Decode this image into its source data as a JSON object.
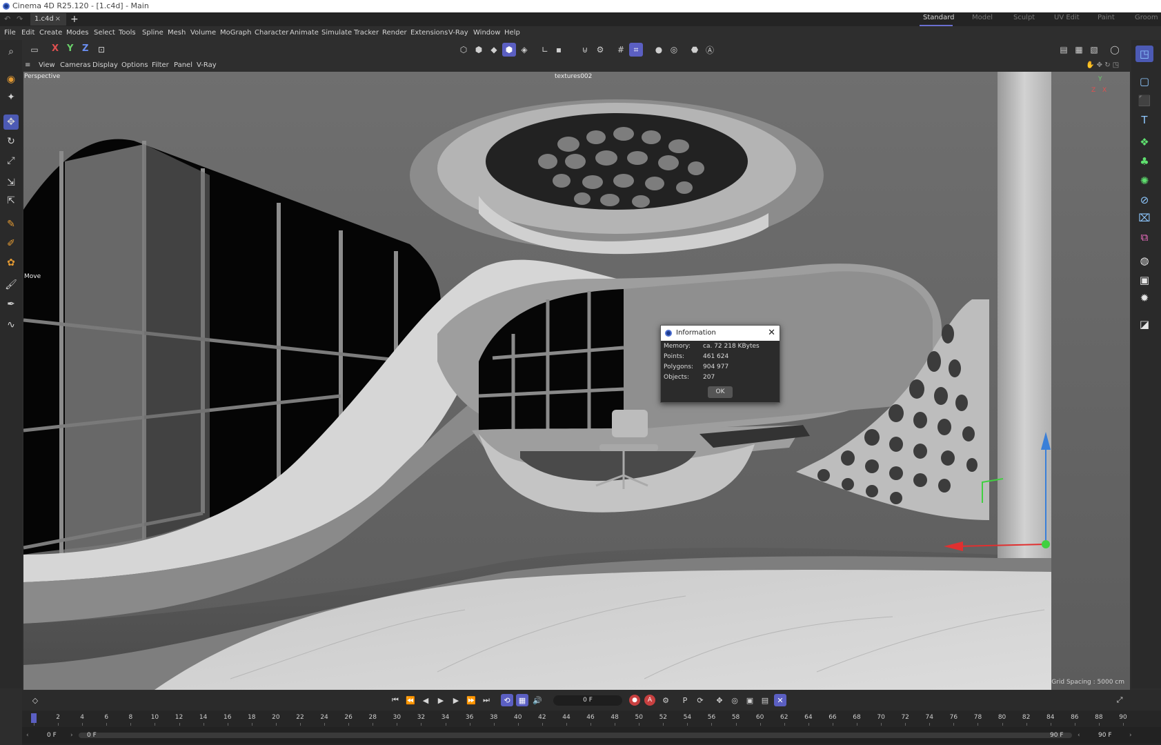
{
  "window": {
    "title": "Cinema 4D R25.120 - [1.c4d] - Main"
  },
  "tabs": {
    "document": "1.c4d",
    "close": "×",
    "new": "+"
  },
  "layouts": [
    "Standard",
    "Model",
    "Sculpt",
    "UV Edit",
    "Paint",
    "Groom"
  ],
  "menu": [
    "File",
    "Edit",
    "Create",
    "Modes",
    "Select",
    "Tools",
    "Spline",
    "Mesh",
    "Volume",
    "MoGraph",
    "Character",
    "Animate",
    "Simulate",
    "Tracker",
    "Render",
    "Extensions",
    "V-Ray",
    "Window",
    "Help"
  ],
  "axes": {
    "x": "X",
    "y": "Y",
    "z": "Z"
  },
  "viewport_menu": [
    "View",
    "Cameras",
    "Display",
    "Options",
    "Filter",
    "Panel",
    "V-Ray"
  ],
  "viewport": {
    "name": "Perspective",
    "texture_label": "textures002",
    "tool_hint": "Move",
    "grid_spacing": "Grid Spacing : 5000 cm",
    "axis_labels": {
      "z": "Z",
      "x": "X",
      "y": "Y"
    }
  },
  "info_dialog": {
    "title": "Information",
    "rows": [
      {
        "key": "Memory:",
        "value": "ca. 72 218 KBytes"
      },
      {
        "key": "Points:",
        "value": "461 624"
      },
      {
        "key": "Polygons:",
        "value": "904 977"
      },
      {
        "key": "Objects:",
        "value": "207"
      }
    ],
    "ok": "OK"
  },
  "timeline": {
    "current_frame": "0 F",
    "ruler": [
      "0",
      "2",
      "4",
      "6",
      "8",
      "10",
      "12",
      "14",
      "16",
      "18",
      "20",
      "22",
      "24",
      "26",
      "28",
      "30",
      "32",
      "34",
      "36",
      "38",
      "40",
      "42",
      "44",
      "46",
      "48",
      "50",
      "52",
      "54",
      "56",
      "58",
      "60",
      "62",
      "64",
      "66",
      "68",
      "70",
      "72",
      "74",
      "76",
      "78",
      "80",
      "82",
      "84",
      "86",
      "88",
      "90"
    ],
    "range_start": "0 F",
    "range_start2": "0 F",
    "range_end": "90 F",
    "range_end2": "90 F"
  },
  "colors": {
    "accent": "#5b5fc2",
    "record": "#c84040"
  }
}
